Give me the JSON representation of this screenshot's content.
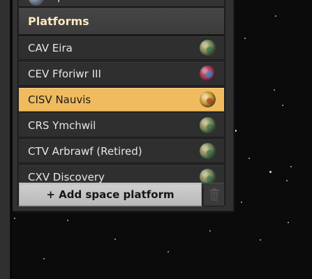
{
  "previous_row": {
    "label": "Up"
  },
  "section": {
    "title": "Platforms"
  },
  "platforms": [
    {
      "name": "CAV Eira",
      "planet_icon": "nauvis-planet-icon",
      "selected": false
    },
    {
      "name": "CEV Fforiwr III",
      "planet_icon": "vulcanus-planet-icon",
      "selected": false
    },
    {
      "name": "CISV Nauvis",
      "planet_icon": "gleba-planet-icon",
      "selected": true
    },
    {
      "name": "CRS Ymchwil",
      "planet_icon": "nauvis-planet-icon",
      "selected": false
    },
    {
      "name": "CTV Arbrawf (Retired)",
      "planet_icon": "nauvis-planet-icon",
      "selected": false
    },
    {
      "name": "CXV Discovery",
      "planet_icon": "nauvis-planet-icon",
      "selected": false
    }
  ],
  "actions": {
    "add_label": "+ Add space platform",
    "delete_icon": "trash-icon"
  },
  "colors": {
    "selected_row": "#f0bb5e",
    "header_text": "#ffe6c0",
    "panel": "#313131"
  }
}
